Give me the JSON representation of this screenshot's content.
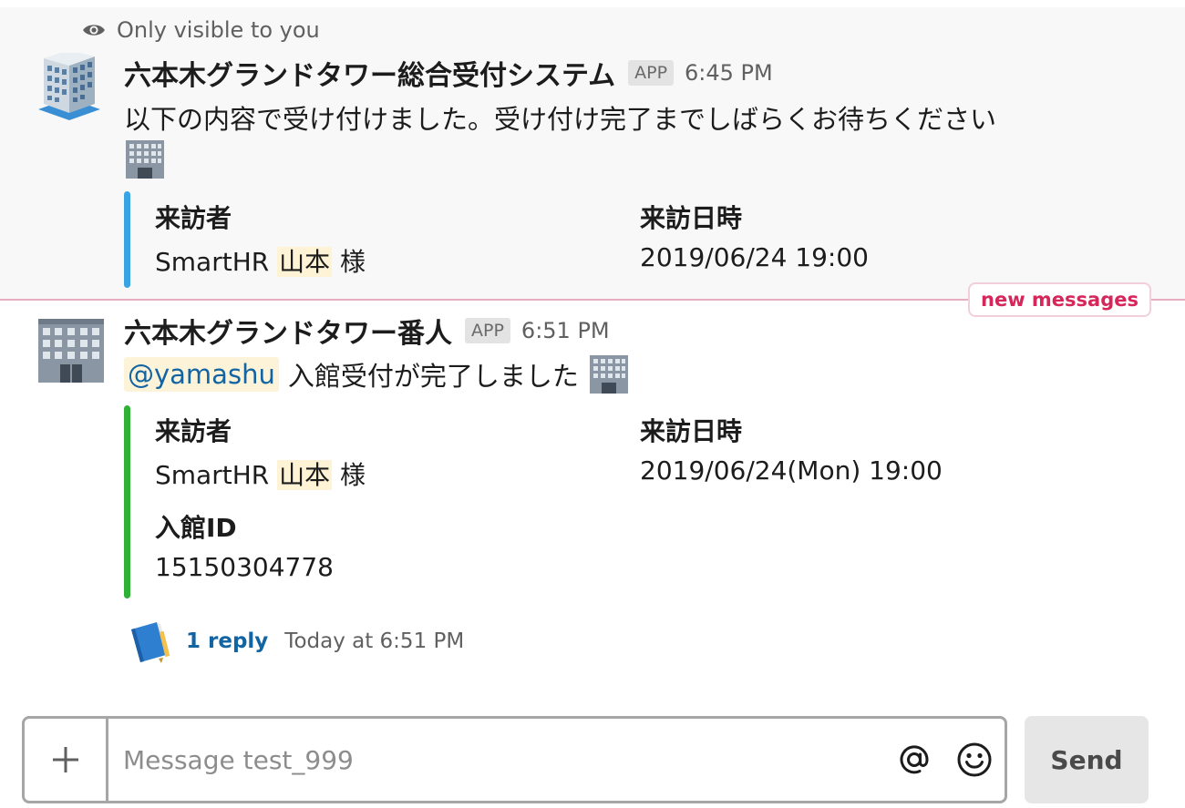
{
  "ephemeral_note": "Only visible to you",
  "messages": [
    {
      "sender": "六本木グランドタワー総合受付システム",
      "badge": "APP",
      "time": "6:45 PM",
      "text": "以下の内容で受け付けました。受け付け完了までしばらくお待ちください",
      "fields": {
        "visitor_label": "来訪者",
        "visitor_prefix": "SmartHR",
        "visitor_name": "山本",
        "visitor_suffix": "様",
        "datetime_label": "来訪日時",
        "datetime_value": "2019/06/24 19:00"
      },
      "bar_color": "#3aa3e3"
    },
    {
      "sender": "六本木グランドタワー番人",
      "badge": "APP",
      "time": "6:51 PM",
      "mention": "@yamashu",
      "text": "入館受付が完了しました",
      "fields": {
        "visitor_label": "来訪者",
        "visitor_prefix": "SmartHR",
        "visitor_name": "山本",
        "visitor_suffix": "様",
        "datetime_label": "来訪日時",
        "datetime_value": "2019/06/24(Mon) 19:00",
        "id_label": "入館ID",
        "id_value": "15150304778"
      },
      "bar_color": "#2eb135"
    }
  ],
  "new_messages_label": "new messages",
  "reply": {
    "count_label": "1 reply",
    "time_label": "Today at 6:51 PM"
  },
  "composer": {
    "placeholder": "Message test_999",
    "send_label": "Send"
  }
}
